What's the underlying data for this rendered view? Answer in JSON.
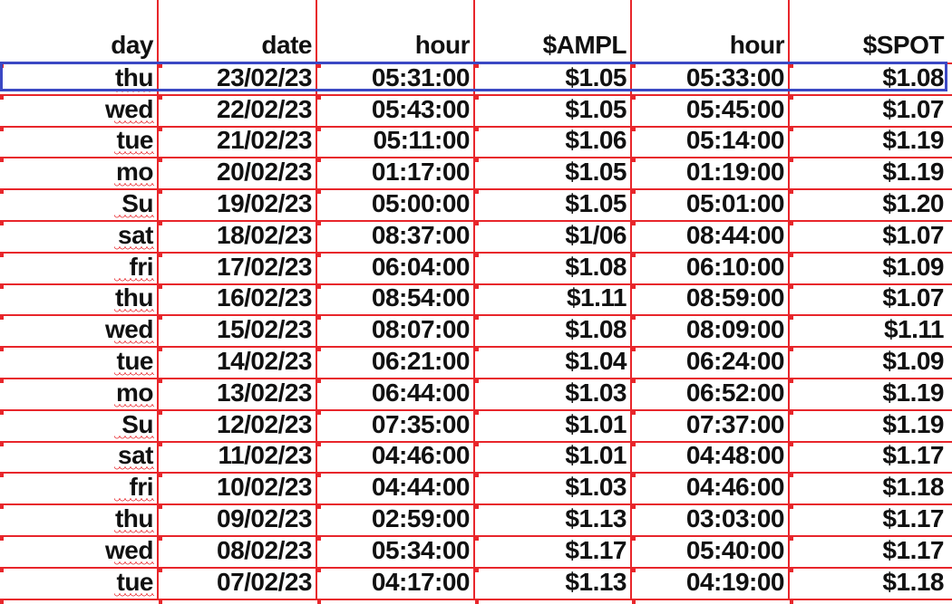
{
  "sheet": {
    "headers": [
      "day",
      "date",
      "hour",
      "$AMPL",
      "hour",
      "$SPOT"
    ],
    "rows": [
      [
        "thu",
        "23/02/23",
        "05:31:00",
        "$1.05",
        "05:33:00",
        "$1.08"
      ],
      [
        "wed",
        "22/02/23",
        "05:43:00",
        "$1.05",
        "05:45:00",
        "$1.07"
      ],
      [
        "tue",
        "21/02/23",
        "05:11:00",
        "$1.06",
        "05:14:00",
        "$1.19"
      ],
      [
        "mo",
        "20/02/23",
        "01:17:00",
        "$1.05",
        "01:19:00",
        "$1.19"
      ],
      [
        "Su",
        "19/02/23",
        "05:00:00",
        "$1.05",
        "05:01:00",
        "$1.20"
      ],
      [
        "sat",
        "18/02/23",
        "08:37:00",
        "$1/06",
        "08:44:00",
        "$1.07"
      ],
      [
        "fri",
        "17/02/23",
        "06:04:00",
        "$1.08",
        "06:10:00",
        "$1.09"
      ],
      [
        "thu",
        "16/02/23",
        "08:54:00",
        "$1.11",
        "08:59:00",
        "$1.07"
      ],
      [
        "wed",
        "15/02/23",
        "08:07:00",
        "$1.08",
        "08:09:00",
        "$1.11"
      ],
      [
        "tue",
        "14/02/23",
        "06:21:00",
        "$1.04",
        "06:24:00",
        "$1.09"
      ],
      [
        "mo",
        "13/02/23",
        "06:44:00",
        "$1.03",
        "06:52:00",
        "$1.19"
      ],
      [
        "Su",
        "12/02/23",
        "07:35:00",
        "$1.01",
        "07:37:00",
        "$1.19"
      ],
      [
        "sat",
        "11/02/23",
        "04:46:00",
        "$1.01",
        "04:48:00",
        "$1.17"
      ],
      [
        "fri",
        "10/02/23",
        "04:44:00",
        "$1.03",
        "04:46:00",
        "$1.18"
      ],
      [
        "thu",
        "09/02/23",
        "02:59:00",
        "$1.13",
        "03:03:00",
        "$1.17"
      ],
      [
        "wed",
        "08/02/23",
        "05:34:00",
        "$1.17",
        "05:40:00",
        "$1.17"
      ],
      [
        "tue",
        "07/02/23",
        "04:17:00",
        "$1.13",
        "04:19:00",
        "$1.18"
      ]
    ],
    "selected_row": 0,
    "colors": {
      "grid": "#e8262b",
      "selection": "#3b48c4",
      "text": "#111111"
    }
  }
}
